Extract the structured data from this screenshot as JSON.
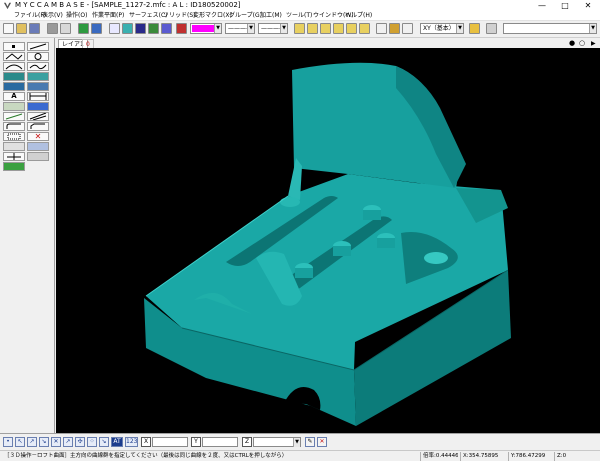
{
  "app": {
    "title": "M Y C C A M B A S E - [SAMPLE_1127-2.mfc : A L : ID180520002]",
    "window_buttons": {
      "minimize": "—",
      "maximize": "□",
      "close": "✕"
    }
  },
  "menu": {
    "items": [
      "ファイル(F)",
      "表示(V)",
      "操作(O)",
      "作業平面(P)",
      "サーフェス(C)",
      "ソリッド(S)",
      "変形マクロ(X)",
      "グループ(G)",
      "加工(M)",
      "ツール(T)",
      "ウインドウ(W)",
      "ヘルプ(H)"
    ]
  },
  "toolbar": {
    "color_swatch": "#ff00ff",
    "line_style": "————",
    "line_width": "————",
    "view_select": "XY（基本）",
    "icons": [
      "new-icon",
      "open-icon",
      "save-icon",
      "grid-icon",
      "snap-icon",
      "layer-icon"
    ]
  },
  "layer_tabs": [
    {
      "label": "レイア1",
      "active": true
    },
    {
      "label": "0",
      "active": false
    }
  ],
  "view_controls": {
    "circle_dot": "●",
    "circle_empty": "○"
  },
  "left_tools": {
    "text_tool": "A",
    "icons": [
      "point-icon",
      "line-icon",
      "polyline-icon",
      "arc-icon",
      "circle-icon",
      "curve-icon",
      "surface-icon",
      "solid-icon",
      "text-icon",
      "dimension-icon",
      "trim-icon",
      "offset-icon",
      "fillet-icon",
      "delete-icon",
      "measure-icon",
      "group-icon"
    ]
  },
  "bottom": {
    "snap_labels": [
      "AT",
      "123"
    ],
    "coord_labels": [
      "X",
      "Y",
      "Z"
    ]
  },
  "status": {
    "message": "［３Ｄ操作－ロフト曲面］主方向の曲線群を指定してください（最後は同じ曲線を２度、又はCTRLを押しながら）",
    "scale": "倍率:0.44446",
    "x": "X:354.75895",
    "y": "Y:786.47299",
    "z": "Z:0"
  },
  "colors": {
    "model": "#139a9a",
    "model_dark": "#0b6e6e",
    "model_light": "#2fc0bc",
    "viewport_bg": "#000000",
    "accent_red": "#c81414"
  }
}
